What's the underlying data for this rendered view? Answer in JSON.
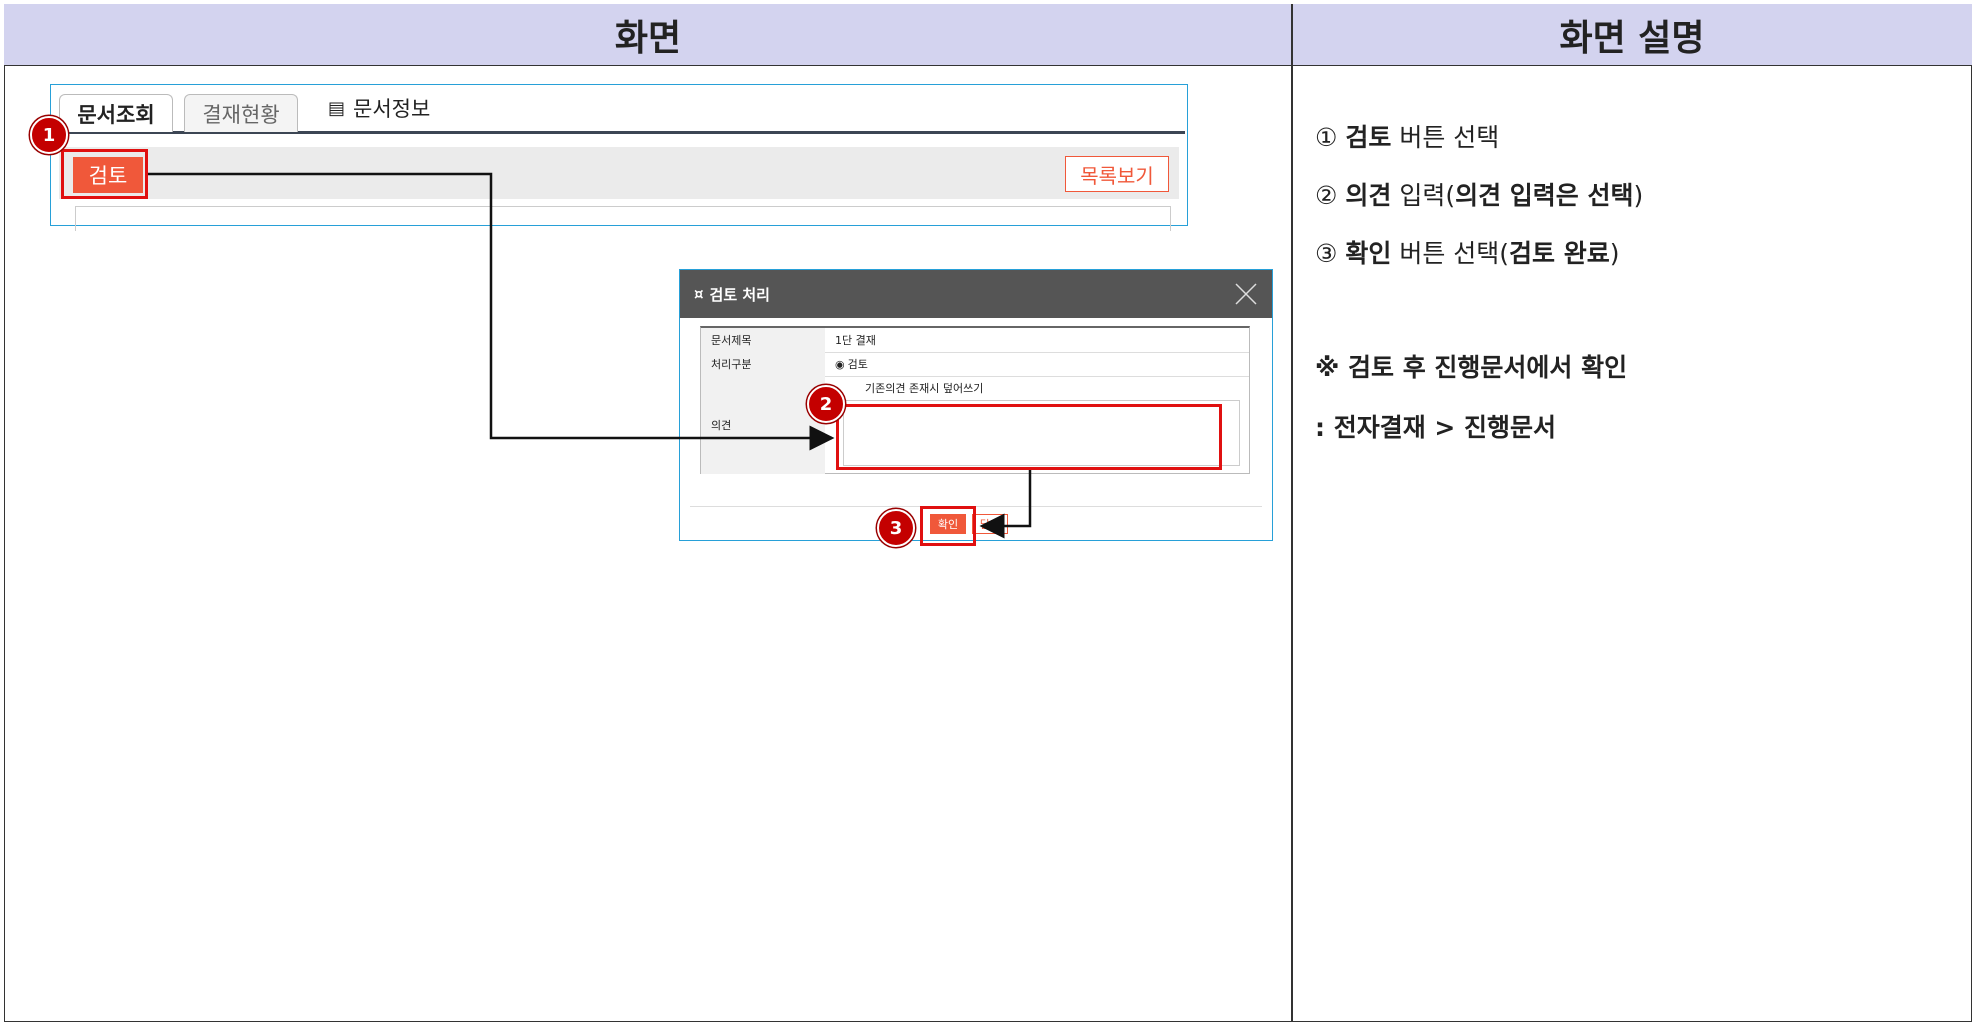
{
  "headers": {
    "screen": "화면",
    "description": "화면 설명"
  },
  "screen": {
    "tabs": [
      "문서조회",
      "결재현황"
    ],
    "doc_info_tab": "문서정보",
    "review_button": "검토",
    "list_button": "목록보기",
    "dialog": {
      "title": "검토 처리",
      "rows": [
        {
          "label": "문서제목",
          "value": "1단 결재"
        },
        {
          "label": "처리구분",
          "value": "검토"
        },
        {
          "label": "의견",
          "overwrite_text": "기존의견 존재시 덮어쓰기"
        }
      ],
      "ok_button": "확인",
      "close_button": "닫기"
    },
    "badges": [
      "1",
      "2",
      "3"
    ]
  },
  "description": {
    "step1": {
      "num": "①",
      "bold": "검토",
      "rest": " 버튼 선택"
    },
    "step2": {
      "num": "②",
      "bold": "의견",
      "mid": " 입력(",
      "bold2": "의견 입력은 선택",
      "end": ")"
    },
    "step3": {
      "num": "③",
      "bold": "확인",
      "mid": " 버튼 선택(",
      "bold2": "검토 완료",
      "end": ")"
    },
    "note1": "※ 검토 후 진행문서에서 확인",
    "note2": ": 전자결재 > 진행문서"
  },
  "colors": {
    "accent": "#f0583a",
    "highlight": "#e01010",
    "header_bg": "#d3d3ef",
    "panel_border": "#27a0d8"
  }
}
